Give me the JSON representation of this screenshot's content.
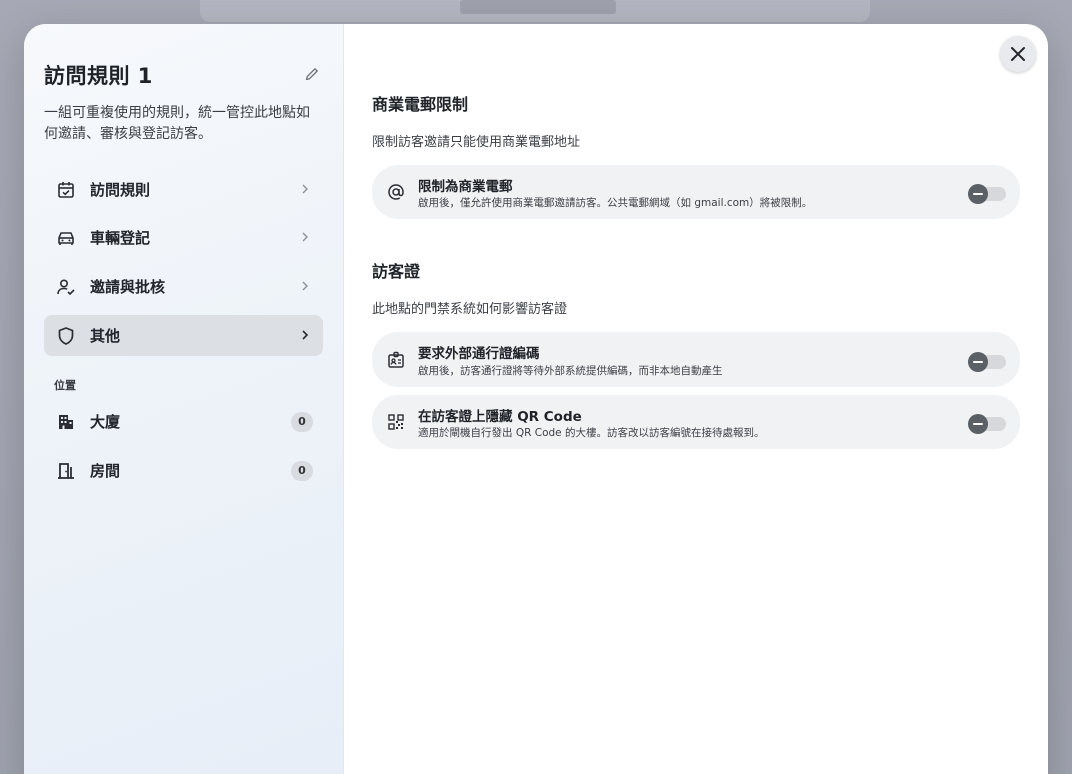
{
  "sidebar": {
    "title": "訪問規則 1",
    "description": "一組可重複使用的規則，統一管控此地點如何邀請、審核與登記訪客。",
    "items": [
      {
        "label": "訪問規則",
        "icon": "calendar-check-icon"
      },
      {
        "label": "車輛登記",
        "icon": "car-icon"
      },
      {
        "label": "邀請與批核",
        "icon": "user-check-icon"
      },
      {
        "label": "其他",
        "icon": "shield-icon"
      }
    ],
    "location_section": "位置",
    "locations": [
      {
        "label": "大廈",
        "count": "0",
        "icon": "building-icon"
      },
      {
        "label": "房間",
        "count": "0",
        "icon": "door-icon"
      }
    ]
  },
  "main": {
    "email_section": {
      "title": "商業電郵限制",
      "subtitle": "限制訪客邀請只能使用商業電郵地址",
      "rows": [
        {
          "title": "限制為商業電郵",
          "description": "啟用後，僅允許使用商業電郵邀請訪客。公共電郵網域（如 gmail.com）將被限制。",
          "icon": "at-sign-icon",
          "enabled": false
        }
      ]
    },
    "pass_section": {
      "title": "訪客證",
      "subtitle": "此地點的門禁系統如何影響訪客證",
      "rows": [
        {
          "title": "要求外部通行證編碼",
          "description": "啟用後，訪客通行證將等待外部系統提供編碼，而非本地自動產生",
          "icon": "id-badge-icon",
          "enabled": false
        },
        {
          "title": "在訪客證上隱藏 QR Code",
          "description": "適用於閘機自行發出 QR Code 的大樓。訪客改以訪客編號在接待處報到。",
          "icon": "qr-code-icon",
          "enabled": false
        }
      ]
    }
  },
  "colors": {
    "active_nav": "#dcdfe4",
    "row_bg": "#f1f2f4",
    "toggle_off_track": "#d6d8dc",
    "toggle_off_knob": "#5b5f66"
  }
}
